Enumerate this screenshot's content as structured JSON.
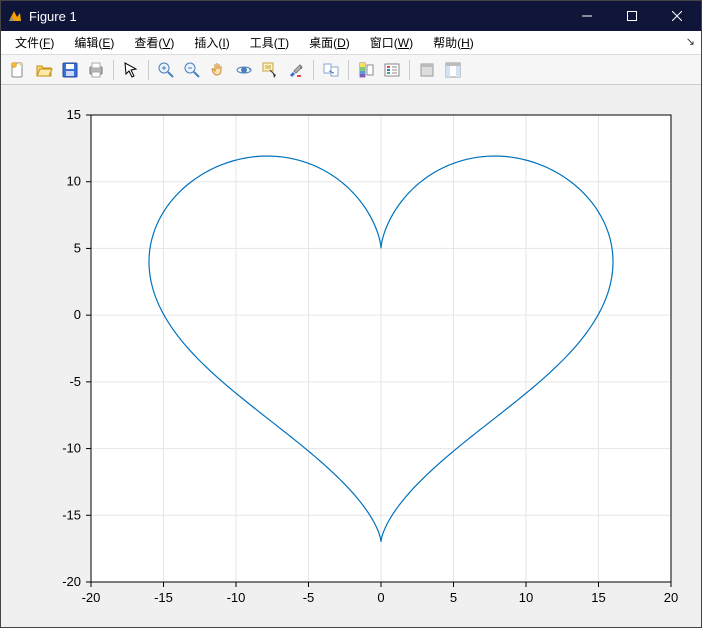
{
  "window": {
    "title": "Figure 1"
  },
  "menus": [
    {
      "label": "文件(",
      "accel": "F",
      "tail": ")"
    },
    {
      "label": "编辑(",
      "accel": "E",
      "tail": ")"
    },
    {
      "label": "查看(",
      "accel": "V",
      "tail": ")"
    },
    {
      "label": "插入(",
      "accel": "I",
      "tail": ")"
    },
    {
      "label": "工具(",
      "accel": "T",
      "tail": ")"
    },
    {
      "label": "桌面(",
      "accel": "D",
      "tail": ")"
    },
    {
      "label": "窗口(",
      "accel": "W",
      "tail": ")"
    },
    {
      "label": "帮助(",
      "accel": "H",
      "tail": ")"
    }
  ],
  "chart_data": {
    "type": "line",
    "title": "",
    "xlabel": "",
    "ylabel": "",
    "xlim": [
      -20,
      20
    ],
    "ylim": [
      -20,
      15
    ],
    "xticks": [
      -20,
      -15,
      -10,
      -5,
      0,
      5,
      10,
      15,
      20
    ],
    "yticks": [
      -20,
      -15,
      -10,
      -5,
      0,
      5,
      10,
      15
    ],
    "grid": true,
    "series": [
      {
        "name": "heart",
        "equation": "x = 16 sin^3(t), y = 13 cos(t) - 5 cos(2t) - 2 cos(3t) - cos(4t), t in [0, 2pi]",
        "approx_range": {
          "x": [
            -16,
            16
          ],
          "y": [
            -17,
            12
          ]
        }
      }
    ]
  }
}
